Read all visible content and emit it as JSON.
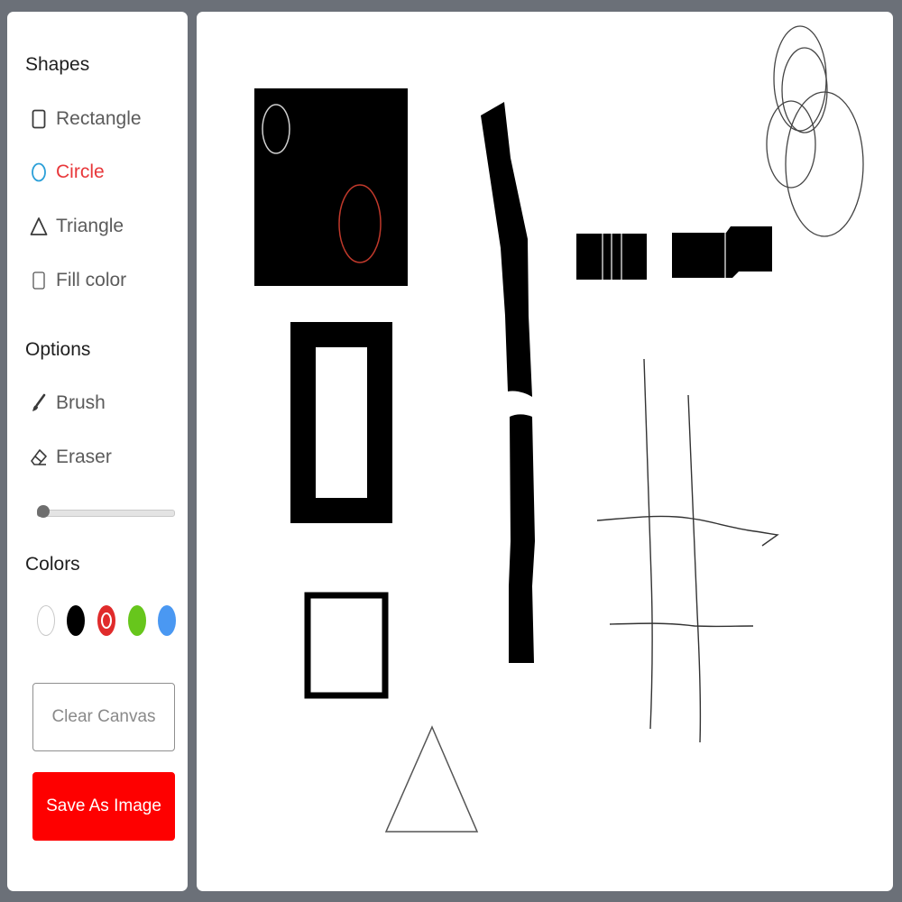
{
  "sidebar": {
    "shapes_title": "Shapes",
    "shapes": [
      {
        "label": "Rectangle",
        "icon": "square-outline-icon",
        "active": false
      },
      {
        "label": "Circle",
        "icon": "circle-outline-icon",
        "active": true
      },
      {
        "label": "Triangle",
        "icon": "triangle-outline-icon",
        "active": false
      },
      {
        "label": "Fill color",
        "icon": "checkbox-icon",
        "checked": false
      }
    ],
    "options_title": "Options",
    "options": [
      {
        "label": "Brush",
        "icon": "brush-icon"
      },
      {
        "label": "Eraser",
        "icon": "eraser-icon"
      }
    ],
    "brush_size": {
      "value": 0.0
    },
    "colors_title": "Colors",
    "colors": [
      {
        "name": "white",
        "hex": "#ffffff",
        "selected": false
      },
      {
        "name": "black",
        "hex": "#000000",
        "selected": false
      },
      {
        "name": "red",
        "hex": "#e02b2b",
        "selected": true
      },
      {
        "name": "green",
        "hex": "#67c61c",
        "selected": false
      },
      {
        "name": "blue",
        "hex": "#4a98f2",
        "selected": false
      }
    ],
    "clear_label": "Clear Canvas",
    "save_label": "Save As Image"
  },
  "theme": {
    "accent": "#e8373a",
    "save_button": "#fe0000",
    "background": "#6b7078"
  }
}
